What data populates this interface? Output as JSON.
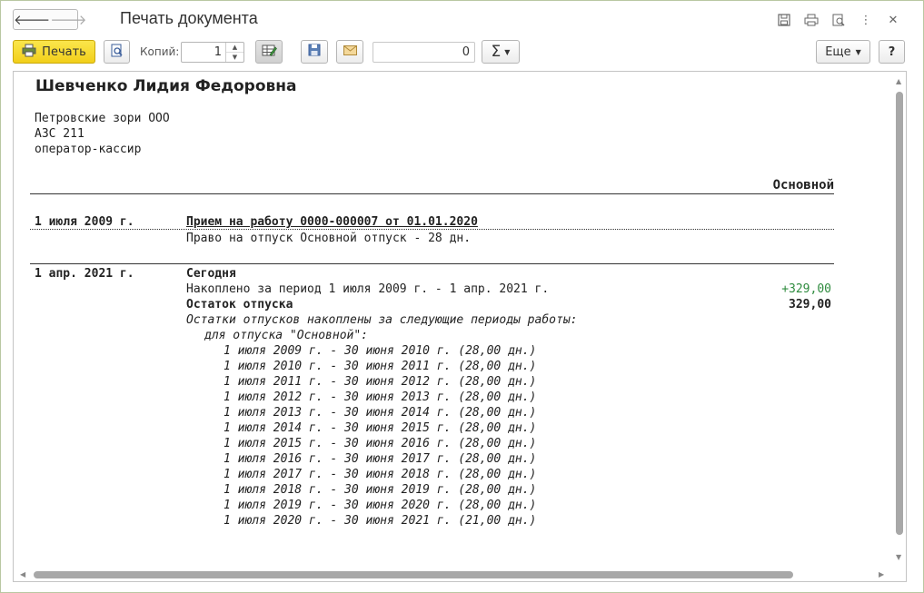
{
  "window": {
    "title": "Печать документа"
  },
  "toolbar": {
    "print_label": "Печать",
    "copies_label": "Копий:",
    "copies_value": "1",
    "sum_value": "0",
    "sigma_symbol": "Σ",
    "more_label": "Еще",
    "help_label": "?"
  },
  "document": {
    "employee_name": "Шевченко Лидия Федоровна",
    "organization": "Петровские зори ООО",
    "department": "АЗС 211",
    "position": "оператор-кассир",
    "column_header": "Основной",
    "entries": [
      {
        "date": "1 июля 2009 г.",
        "event": "Прием на работу 0000-000007 от 01.01.2020",
        "detail": "Право на отпуск Основной отпуск - 28 дн."
      },
      {
        "date": "1 апр. 2021 г.",
        "event": "Сегодня",
        "accrued_text": "Накоплено за период 1 июля 2009 г. - 1 апр. 2021 г.",
        "accrued_value": "+329,00",
        "balance_label": "Остаток отпуска",
        "balance_value": "329,00",
        "periods_intro": "Остатки отпусков накоплены за следующие периоды работы:",
        "periods_for": "для отпуска \"Основной\":",
        "periods": [
          "1 июля 2009 г. - 30 июня 2010 г. (28,00 дн.)",
          "1 июля 2010 г. - 30 июня 2011 г. (28,00 дн.)",
          "1 июля 2011 г. - 30 июня 2012 г. (28,00 дн.)",
          "1 июля 2012 г. - 30 июня 2013 г. (28,00 дн.)",
          "1 июля 2013 г. - 30 июня 2014 г. (28,00 дн.)",
          "1 июля 2014 г. - 30 июня 2015 г. (28,00 дн.)",
          "1 июля 2015 г. - 30 июня 2016 г. (28,00 дн.)",
          "1 июля 2016 г. - 30 июня 2017 г. (28,00 дн.)",
          "1 июля 2017 г. - 30 июня 2018 г. (28,00 дн.)",
          "1 июля 2018 г. - 30 июня 2019 г. (28,00 дн.)",
          "1 июля 2019 г. - 30 июня 2020 г. (28,00 дн.)",
          "1 июля 2020 г. - 30 июня 2021 г. (21,00 дн.)"
        ]
      }
    ]
  },
  "colors": {
    "print_button": "#f4d42a",
    "positive_value": "#2e8b3e"
  }
}
